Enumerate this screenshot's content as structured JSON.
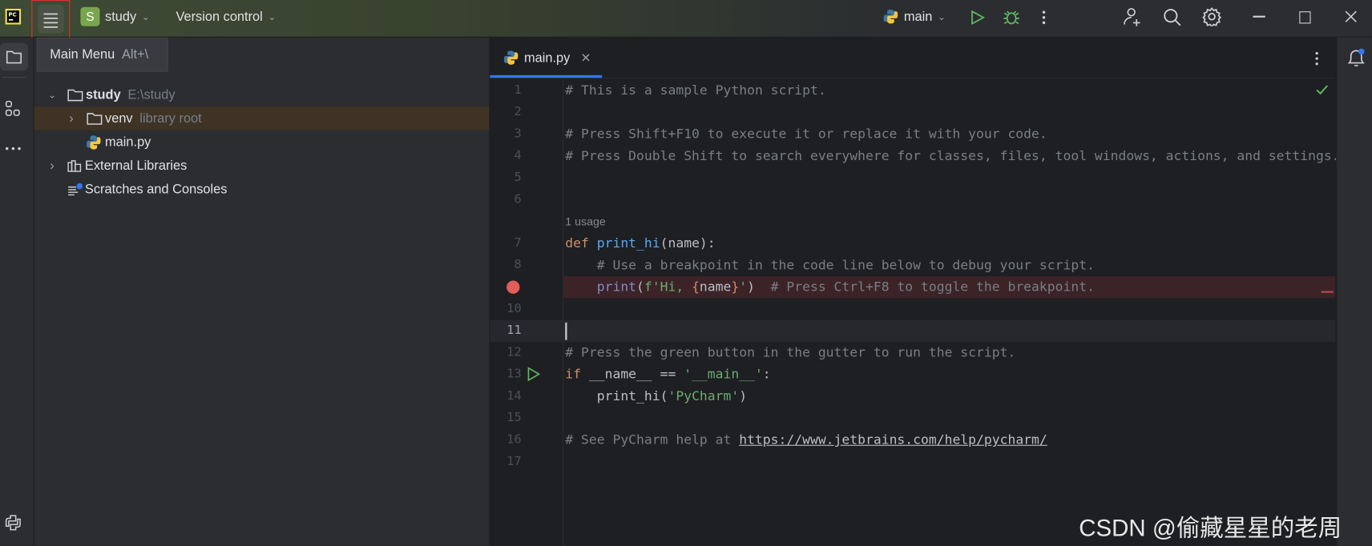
{
  "titlebar": {
    "project_initial": "S",
    "project_name": "study",
    "vcs_label": "Version control",
    "run_config": "main",
    "icons": [
      "pycharm-logo",
      "hamburger-menu-icon",
      "chevron-down-icon",
      "python-icon",
      "run-icon",
      "debug-icon",
      "more-icon",
      "add-user-icon",
      "search-icon",
      "settings-icon",
      "minimize-icon",
      "maximize-icon",
      "close-icon"
    ]
  },
  "tooltip": {
    "label": "Main Menu",
    "shortcut": "Alt+\\"
  },
  "project_tree": [
    {
      "name": "study",
      "hint": "E:\\study",
      "type": "folder",
      "expanded": true
    },
    {
      "name": "venv",
      "hint": "library root",
      "type": "folder",
      "expanded": false,
      "highlighted": true
    },
    {
      "name": "main.py",
      "hint": "",
      "type": "python-file"
    },
    {
      "name": "External Libraries",
      "hint": "",
      "type": "libraries",
      "expanded": false
    },
    {
      "name": "Scratches and Consoles",
      "hint": "",
      "type": "scratches"
    }
  ],
  "editor": {
    "tab": "main.py",
    "usage_hint": "1 usage",
    "current_line": 11,
    "breakpoint_line": 9,
    "run_gutter_line": 13,
    "lines": [
      {
        "n": "1",
        "tokens": [
          [
            "# This is a sample Python script.",
            "comment"
          ]
        ]
      },
      {
        "n": "2",
        "tokens": []
      },
      {
        "n": "3",
        "tokens": [
          [
            "# Press Shift+F10 to execute it or replace it with your code.",
            "comment"
          ]
        ]
      },
      {
        "n": "4",
        "tokens": [
          [
            "# Press Double Shift to search everywhere for classes, files, tool windows, actions, and settings.",
            "comment"
          ]
        ]
      },
      {
        "n": "5",
        "tokens": []
      },
      {
        "n": "6",
        "tokens": []
      },
      {
        "n": "7",
        "tokens": [
          [
            "def ",
            "keyword"
          ],
          [
            "print_hi",
            "func"
          ],
          [
            "(name):",
            "plain"
          ]
        ]
      },
      {
        "n": "8",
        "tokens": [
          [
            "    # Use a breakpoint in the code line below to debug your script.",
            "comment"
          ]
        ]
      },
      {
        "n": "",
        "tokens": [
          [
            "    ",
            "plain"
          ],
          [
            "print",
            "builtin"
          ],
          [
            "(",
            "plain"
          ],
          [
            "f'Hi, ",
            "string"
          ],
          [
            "{",
            "brace"
          ],
          [
            "name",
            "plain"
          ],
          [
            "}",
            "brace"
          ],
          [
            "'",
            "string"
          ],
          [
            ")  ",
            "plain"
          ],
          [
            "# Press Ctrl+F8 to toggle the breakpoint.",
            "comment"
          ]
        ]
      },
      {
        "n": "10",
        "tokens": []
      },
      {
        "n": "11",
        "tokens": []
      },
      {
        "n": "12",
        "tokens": [
          [
            "# Press the green button in the gutter to run the script.",
            "comment"
          ]
        ]
      },
      {
        "n": "13",
        "tokens": [
          [
            "if ",
            "keyword"
          ],
          [
            "__name__ == ",
            "plain"
          ],
          [
            "'__main__'",
            "string"
          ],
          [
            ":",
            "plain"
          ]
        ]
      },
      {
        "n": "14",
        "tokens": [
          [
            "    print_hi(",
            "plain"
          ],
          [
            "'PyCharm'",
            "string"
          ],
          [
            ")",
            "plain"
          ]
        ]
      },
      {
        "n": "15",
        "tokens": []
      },
      {
        "n": "16",
        "tokens": [
          [
            "# See PyCharm help at ",
            "comment"
          ],
          [
            "https://www.jetbrains.com/help/pycharm/",
            "link"
          ]
        ]
      },
      {
        "n": "17",
        "tokens": []
      }
    ]
  },
  "watermark": "CSDN @偷藏星星的老周",
  "colors": {
    "accent": "#3574f0",
    "run": "#5fb865",
    "breakpoint": "#e55c5c",
    "highlight_box": "#e03030"
  }
}
